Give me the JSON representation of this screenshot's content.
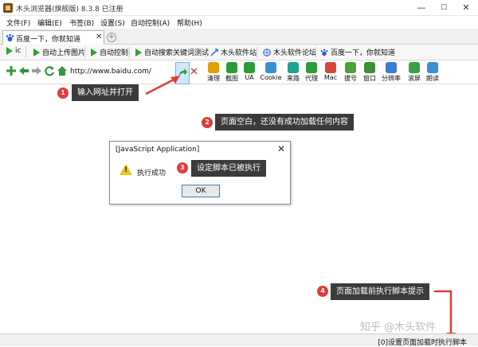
{
  "window": {
    "title": "木头浏览器(旗舰版) 8.3.8  已注册",
    "min": "—",
    "max": "☐",
    "close": "✕"
  },
  "menu": [
    "文件(F)",
    "编辑(E)",
    "书签(B)",
    "设置(S)",
    "自动控制(A)",
    "帮助(H)"
  ],
  "tab": {
    "label": "百度一下，你就知道",
    "close": "✕",
    "new": "+"
  },
  "bookmarks": [
    {
      "label": "ic",
      "icon": "green-play-icon"
    },
    {
      "label": "自动上传图片",
      "icon": "green-play-icon"
    },
    {
      "label": "自动控制",
      "icon": "green-play-icon"
    },
    {
      "label": "自动搜索关键词测试",
      "icon": "green-play-icon"
    },
    {
      "label": "木头软件站",
      "icon": "link-icon"
    },
    {
      "label": "木头软件论坛",
      "icon": "globe-icon"
    },
    {
      "label": "百度一下，你就知道",
      "icon": "paw-icon"
    }
  ],
  "nav": {
    "url": "http://www.baidu.com/"
  },
  "tools": [
    {
      "label": "清理",
      "color": "#e0a000"
    },
    {
      "label": "截图",
      "color": "#2e9a3a"
    },
    {
      "label": "UA",
      "color": "#2e9a3a"
    },
    {
      "label": "Cookie",
      "color": "#3a8fd6"
    },
    {
      "label": "来路",
      "color": "#1fa38c"
    },
    {
      "label": "代理",
      "color": "#2e9a3a"
    },
    {
      "label": "Mac",
      "color": "#d8453b"
    },
    {
      "label": "拔号",
      "color": "#4ba33a"
    },
    {
      "label": "窗口",
      "color": "#3c8f2e"
    },
    {
      "label": "分辨率",
      "color": "#3a7bd6"
    },
    {
      "label": "滚屏",
      "color": "#3aa04a"
    },
    {
      "label": "朗读",
      "color": "#3a8fd6"
    }
  ],
  "callouts": [
    {
      "n": "1",
      "text": "输入网址并打开"
    },
    {
      "n": "2",
      "text": "页面空白，还没有成功加载任何内容"
    },
    {
      "n": "3",
      "text": "设定脚本已被执行"
    },
    {
      "n": "4",
      "text": "页面加载前执行脚本提示"
    }
  ],
  "dialog": {
    "title": "[JavaScript Application]",
    "close": "✕",
    "message": "执行成功",
    "ok": "OK"
  },
  "status": {
    "text": "[0]设置页面加载时执行脚本"
  },
  "watermark": "知乎 @木头软件",
  "colors": {
    "accent": "#e23b3b",
    "callout_bg": "#3b3b3b",
    "go_button": "#cfe8fb"
  }
}
